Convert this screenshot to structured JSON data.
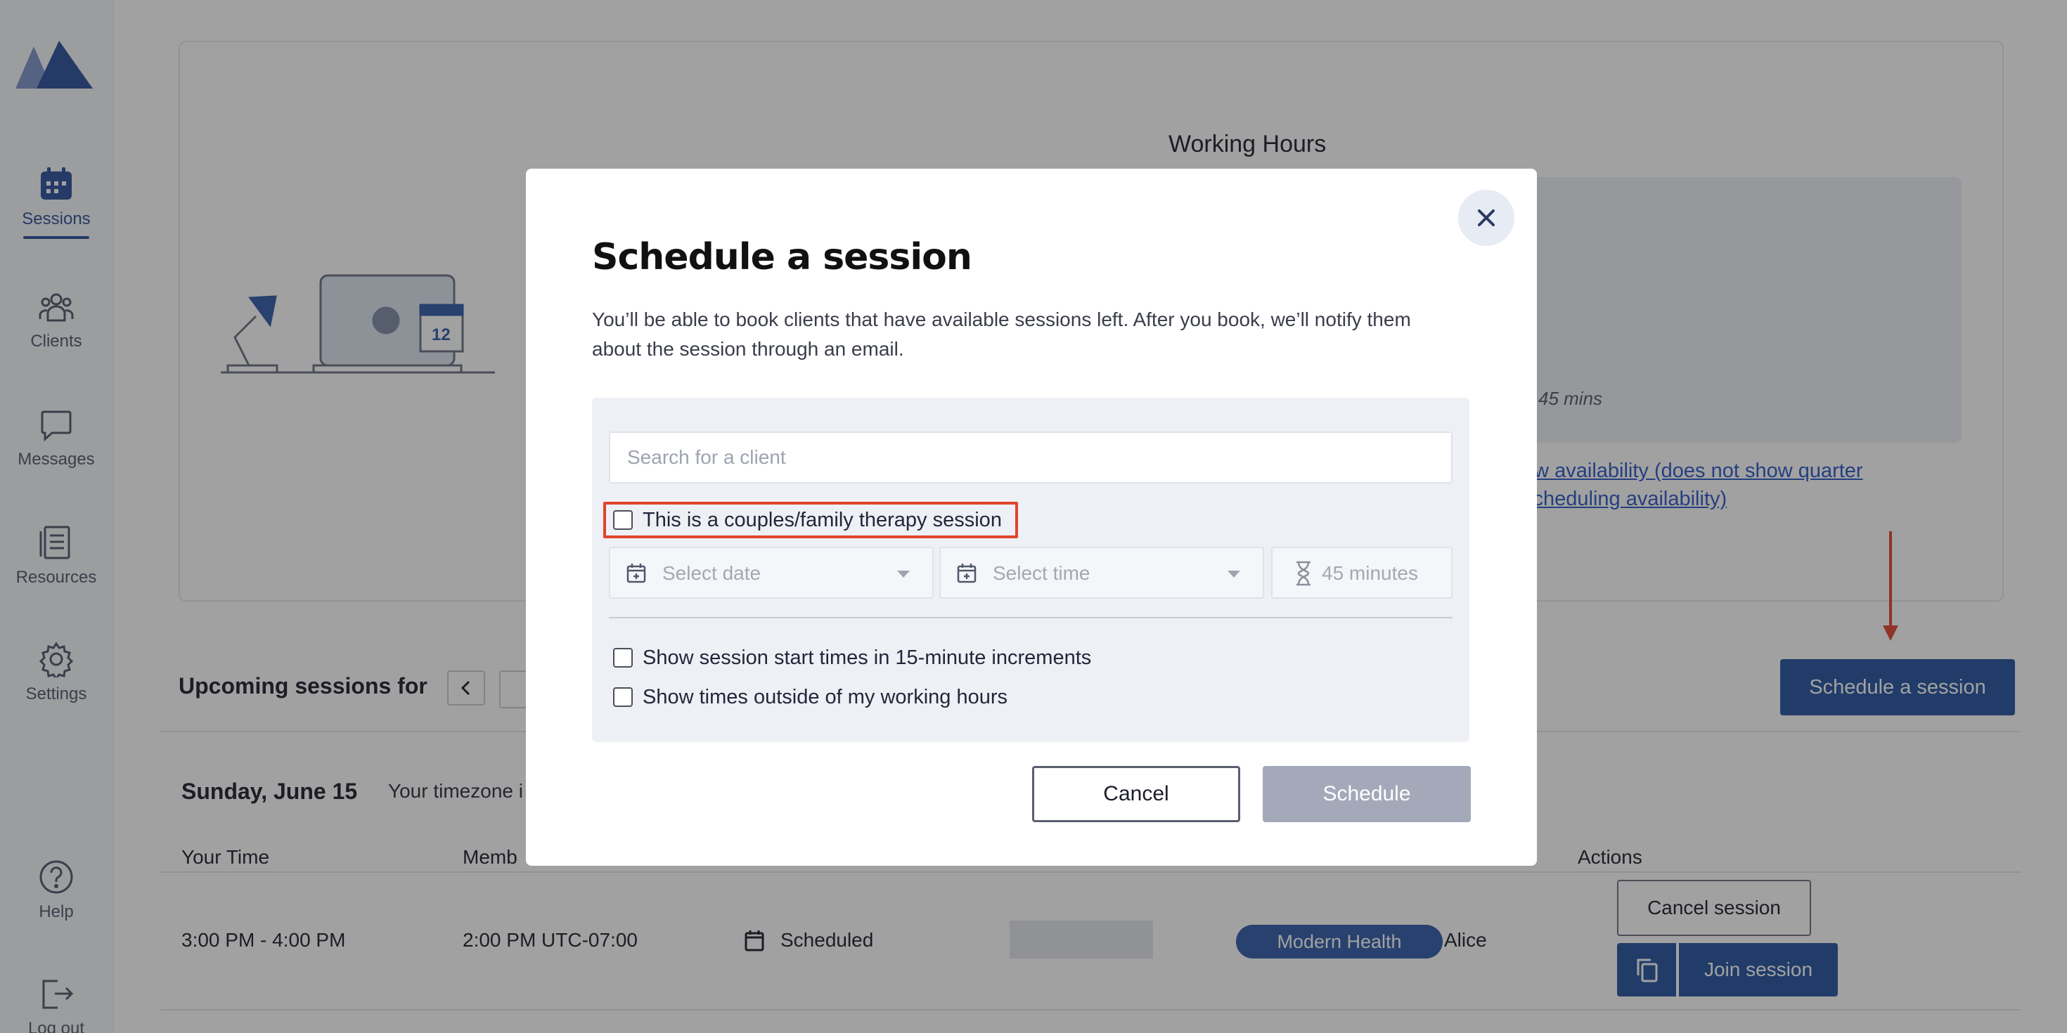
{
  "sidebar": {
    "items": [
      {
        "label": "Sessions",
        "icon": "calendar-icon"
      },
      {
        "label": "Clients",
        "icon": "users-icon"
      },
      {
        "label": "Messages",
        "icon": "chat-icon"
      },
      {
        "label": "Resources",
        "icon": "document-icon"
      },
      {
        "label": "Settings",
        "icon": "gear-icon"
      },
      {
        "label": "Help",
        "icon": "help-icon"
      },
      {
        "label": "Log out",
        "icon": "logout-icon"
      }
    ],
    "active": "Sessions"
  },
  "background": {
    "working_hours_title": "Working Hours",
    "working_duration": "45 mins",
    "availability_link": "ew availability (does not show quarter scheduling availability)",
    "schedule_button": "Schedule a session",
    "upcoming_label": "Upcoming sessions for",
    "day_label": "Sunday, June 15",
    "timezone_label": "Your timezone i",
    "table": {
      "headers": [
        "Your Time",
        "Memb",
        "Actions"
      ],
      "row": {
        "your_time": "3:00 PM - 4:00 PM",
        "member_time": "2:00 PM UTC-07:00",
        "status": "Scheduled",
        "partner": "Modern Health",
        "client": "Alice",
        "cancel_label": "Cancel session",
        "join_label": "Join session"
      }
    }
  },
  "modal": {
    "title": "Schedule a session",
    "description": "You’ll be able to book clients that have available sessions left. After you book, we’ll notify them about the session through an email.",
    "search_placeholder": "Search for a client",
    "couples_label": "This is a couples/family therapy session",
    "date_placeholder": "Select date",
    "time_placeholder": "Select time",
    "duration": "45 minutes",
    "increments_label": "Show session start times in 15-minute increments",
    "outside_hours_label": "Show times outside of my working hours",
    "cancel_label": "Cancel",
    "schedule_label": "Schedule"
  },
  "colors": {
    "brand": "#24519f",
    "highlight": "#e0442b",
    "disabled": "#a4a9ba"
  }
}
